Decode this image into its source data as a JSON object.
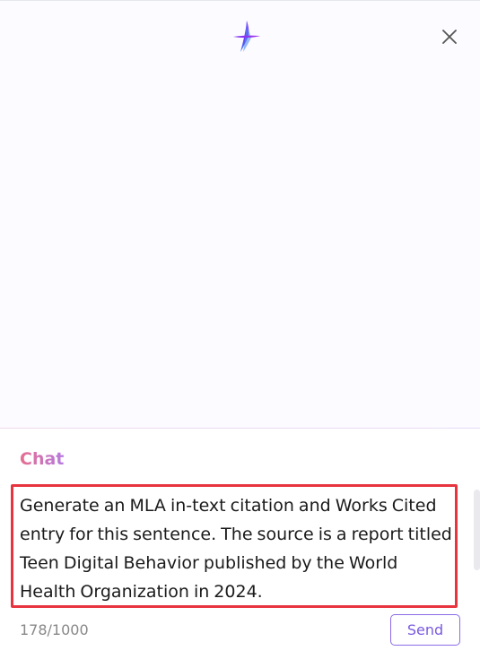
{
  "header": {
    "logo_icon": "sparkle-star-icon",
    "close_icon": "close-icon"
  },
  "chat": {
    "title": "Chat",
    "input_value": "Generate an MLA in-text citation and Works Cited entry for this sentence. The source is a report titled Teen Digital Behavior published by the World Health Organization in 2024.",
    "char_count": "178/1000",
    "send_label": "Send"
  },
  "colors": {
    "accent_purple": "#7a5ae0",
    "highlight_red": "#e8343f",
    "title_gradient_start": "#e86d8f",
    "title_gradient_end": "#b57ae0"
  }
}
